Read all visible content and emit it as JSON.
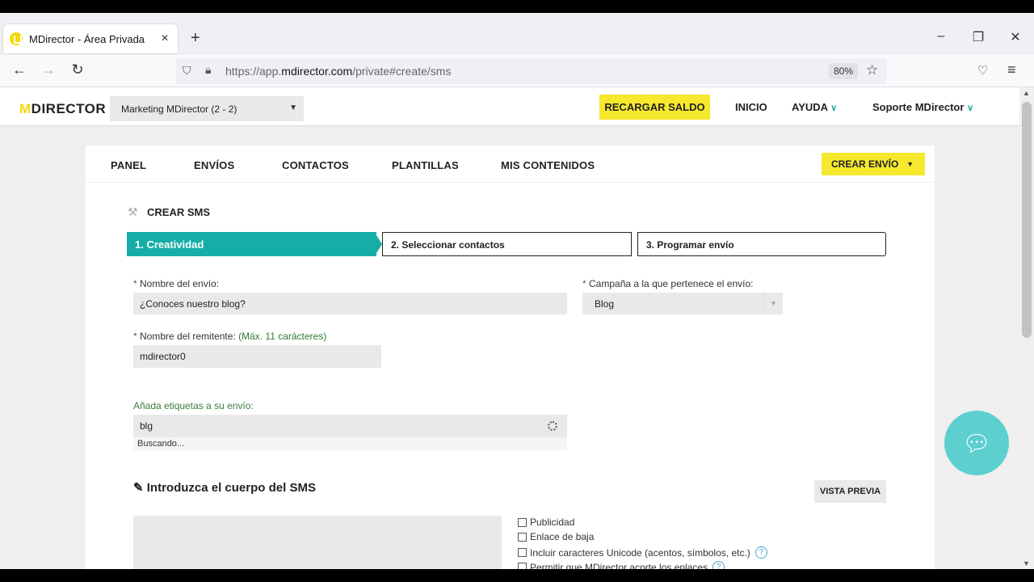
{
  "browser": {
    "tab_title": "MDirector - Área Privada",
    "url_prefix": "https://app.",
    "url_domain": "mdirector.com",
    "url_path": "/private#create/sms",
    "zoom": "80%"
  },
  "header": {
    "logo_m": "M",
    "logo_text": "DIRECTOR",
    "account": "Marketing MDirector (2 - 2)",
    "recargar": "RECARGAR SALDO",
    "inicio": "INICIO",
    "ayuda": "AYUDA",
    "soporte": "Soporte MDirector"
  },
  "mainnav": {
    "items": [
      "PANEL",
      "ENVÍOS",
      "CONTACTOS",
      "PLANTILLAS",
      "MIS CONTENIDOS"
    ],
    "crear_envio": "CREAR ENVÍO"
  },
  "form": {
    "section_title": "CREAR SMS",
    "steps": [
      "1. Creatividad",
      "2. Seleccionar contactos",
      "3. Programar envío"
    ],
    "nombre_envio_label": "Nombre del envío:",
    "nombre_envio_value": "¿Conoces nuestro blog?",
    "campana_label": "Campaña a la que pertenece el envío:",
    "campana_value": "Blog",
    "remitente_label": "Nombre del remitente:",
    "remitente_hint": "(Máx. 11 carácteres)",
    "remitente_value": "mdirector0",
    "etiquetas_label": "Añada etiquetas a su envío:",
    "etiquetas_value": "blg",
    "buscando": "Buscando...",
    "cuerpo_title": "Introduzca el cuerpo del SMS",
    "vista_previa": "VISTA PREVIA",
    "options": [
      "Publicidad",
      "Enlace de baja",
      "Incluir caracteres Unicode (acentos, símbolos, etc.)",
      "Permitir que MDirector acorte los enlaces"
    ]
  },
  "colors": {
    "accent_yellow": "#f6e82d",
    "step_teal": "#15aea7",
    "chat_teal": "#5ccfce"
  }
}
